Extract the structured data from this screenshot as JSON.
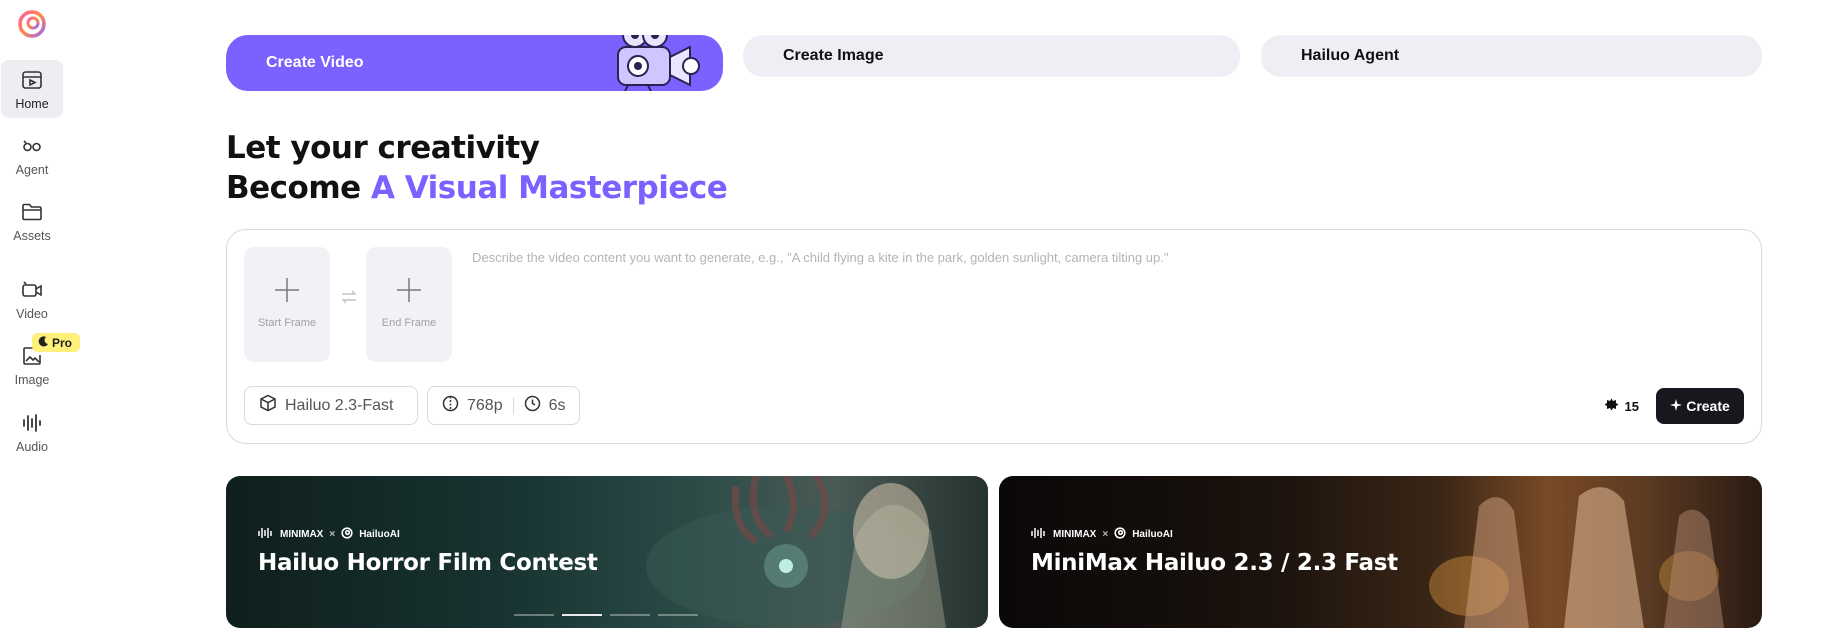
{
  "sidebar": {
    "items": [
      {
        "label": "Home",
        "icon": "home-icon",
        "active": true
      },
      {
        "label": "Agent",
        "icon": "infinity-icon"
      },
      {
        "label": "Assets",
        "icon": "folder-icon"
      },
      {
        "label": "Video",
        "icon": "video-icon"
      },
      {
        "label": "Image",
        "icon": "image-icon"
      },
      {
        "label": "Audio",
        "icon": "audio-wave-icon"
      }
    ],
    "pro_badge": "Pro"
  },
  "tabs": [
    {
      "label": "Create Video",
      "active": true
    },
    {
      "label": "Create Image"
    },
    {
      "label": "Hailuo Agent"
    }
  ],
  "headline": {
    "line1": "Let your creativity",
    "line2_prefix": "Become ",
    "line2_accent": "A Visual Masterpiece"
  },
  "composer": {
    "start_frame": "Start Frame",
    "end_frame": "End Frame",
    "placeholder": "Describe the video content you want to generate, e.g., \"A child flying a kite in the park, golden sunlight, camera tilting up.\"",
    "model": "Hailuo 2.3-Fast",
    "resolution": "768p",
    "duration": "6s",
    "credits": "15",
    "create_label": "Create"
  },
  "banners": [
    {
      "brand_left": "MINIMAX",
      "brand_sep": "×",
      "brand_right": "HailuoAI",
      "title": "Hailuo Horror Film Contest"
    },
    {
      "brand_left": "MINIMAX",
      "brand_sep": "×",
      "brand_right": "HailuoAI",
      "title": "MiniMax Hailuo 2.3 / 2.3 Fast"
    }
  ],
  "colors": {
    "accent": "#7b61ff",
    "dark": "#16181d",
    "tab_bg": "#eeeff4",
    "pro": "#fff07a"
  }
}
